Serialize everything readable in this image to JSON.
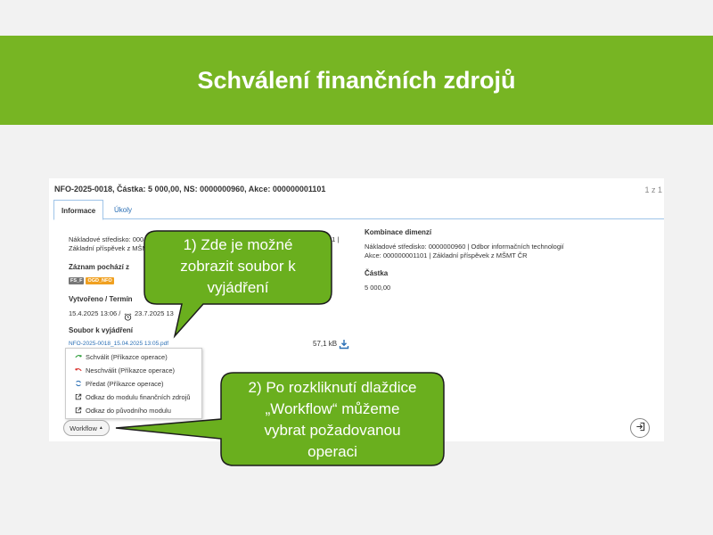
{
  "slide": {
    "title": "Schválení finančních zdrojů"
  },
  "record": {
    "title": "NFO-2025-0018, Částka: 5 000,00, NS: 0000000960, Akce: 000000001101",
    "pager": "1 z 1"
  },
  "tabs": [
    {
      "label": "Informace"
    },
    {
      "label": "Úkoly"
    }
  ],
  "left": {
    "cost_center_line1": "Nákladové středisko: 000",
    "cost_center_line1_end": "01 |",
    "cost_center_line2": "Základní příspěvek z MŠM",
    "origin_label": "Záznam pochází z",
    "badges": [
      "FS_F",
      "OGD_NFO"
    ],
    "created_label": "Vytvořeno / Termín",
    "created_value": "15.4.2025 13:06 /",
    "deadline_value": "23.7.2025 13",
    "file_label": "Soubor k vyjádření",
    "file_name": "NFO-2025-0018_15.04.2025 13:05.pdf",
    "file_size": "57,1 kB"
  },
  "right": {
    "combo_label": "Kombinace dimenzí",
    "combo_line1": "Nákladové středisko: 0000000960 | Odbor informačních technologií",
    "combo_line2": "Akce: 000000001101 | Základní příspěvek z MŠMT ČR",
    "amount_label": "Částka",
    "amount_value": "5 000,00"
  },
  "workflow_menu": {
    "items": [
      {
        "label": "Schválit (Příkazce operace)",
        "icon": "approve-arrow-icon",
        "color": "#2e9d3a"
      },
      {
        "label": "Neschválit (Příkazce operace)",
        "icon": "reject-arrow-icon",
        "color": "#d9302c"
      },
      {
        "label": "Předat (Příkazce operace)",
        "icon": "handover-icon",
        "color": "#2a6fb5"
      },
      {
        "label": "Odkaz do modulu finančních zdrojů",
        "icon": "external-link-icon",
        "color": "#333333"
      },
      {
        "label": "Odkaz do původního modulu",
        "icon": "external-link-icon",
        "color": "#333333"
      }
    ],
    "button_label": "Workflow"
  },
  "callouts": {
    "first": [
      "1) Zde je možné",
      "zobrazit soubor k",
      "vyjádření"
    ],
    "second": [
      "2) Po rozkliknutí dlaždice",
      "„Workflow“ můžeme",
      "vybrat požadovanou",
      "operaci"
    ]
  },
  "colors": {
    "brand_green": "#77b523",
    "callout_green": "#6aaf1e",
    "link_blue": "#2a6fb5"
  }
}
